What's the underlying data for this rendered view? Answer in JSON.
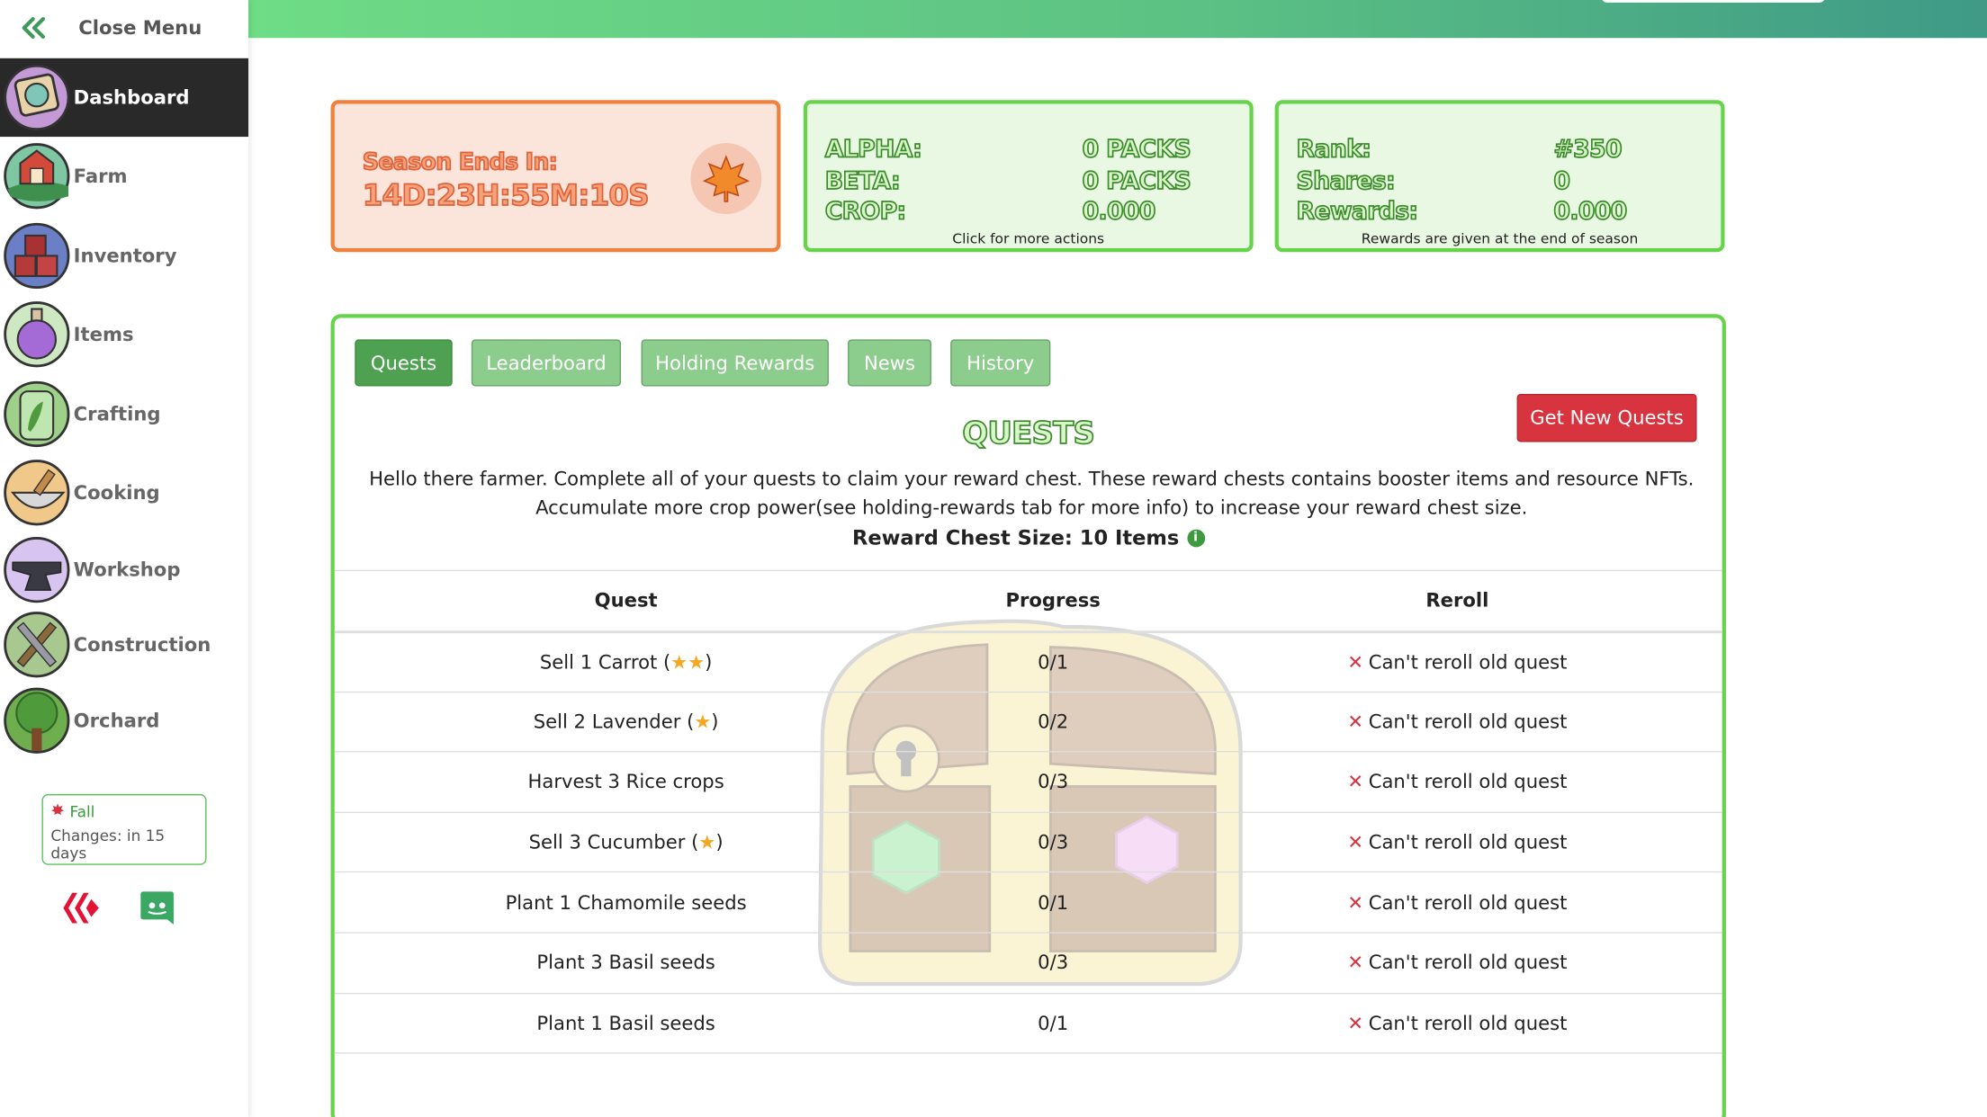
{
  "sidebar": {
    "close_menu": "Close Menu",
    "items": [
      {
        "label": "Dashboard"
      },
      {
        "label": "Farm"
      },
      {
        "label": "Inventory"
      },
      {
        "label": "Items"
      },
      {
        "label": "Crafting"
      },
      {
        "label": "Cooking"
      },
      {
        "label": "Workshop"
      },
      {
        "label": "Construction"
      },
      {
        "label": "Orchard"
      }
    ],
    "season": {
      "name": "Fall",
      "changes": "Changes: in 15 days"
    }
  },
  "cards": {
    "season": {
      "title": "Season Ends In:",
      "time": "14D:23H:55M:10S"
    },
    "packs": {
      "rows": [
        {
          "label": "ALPHA:",
          "value": "0 PACKS"
        },
        {
          "label": "BETA:",
          "value": "0 PACKS"
        },
        {
          "label": "CROP:",
          "value": "0.000"
        }
      ],
      "note": "Click for more actions"
    },
    "rank": {
      "rows": [
        {
          "label": "Rank:",
          "value": "#350"
        },
        {
          "label": "Shares:",
          "value": "0"
        },
        {
          "label": "Rewards:",
          "value": "0.000"
        }
      ],
      "note": "Rewards are given at the end of season"
    }
  },
  "tabs": [
    {
      "label": "Quests",
      "active": true
    },
    {
      "label": "Leaderboard"
    },
    {
      "label": "Holding Rewards"
    },
    {
      "label": "News"
    },
    {
      "label": "History"
    }
  ],
  "quests": {
    "new_button": "Get New Quests",
    "title": "QUESTS",
    "intro": "Hello there farmer. Complete all of your quests to claim your reward chest. These reward chests contains booster items and resource NFTs. Accumulate more crop power(see holding-rewards tab for more info) to increase your reward chest size.",
    "chest_size": "Reward Chest Size: 10 Items",
    "headers": {
      "quest": "Quest",
      "progress": "Progress",
      "reroll": "Reroll"
    },
    "rows": [
      {
        "quest": "Sell 1 Carrot",
        "stars": 2,
        "progress": "0/1",
        "reroll": "Can't reroll old quest"
      },
      {
        "quest": "Sell 2 Lavender",
        "stars": 1,
        "progress": "0/2",
        "reroll": "Can't reroll old quest"
      },
      {
        "quest": "Harvest 3 Rice crops",
        "stars": 0,
        "progress": "0/3",
        "reroll": "Can't reroll old quest"
      },
      {
        "quest": "Sell 3 Cucumber",
        "stars": 1,
        "progress": "0/3",
        "reroll": "Can't reroll old quest"
      },
      {
        "quest": "Plant 1 Chamomile seeds",
        "stars": 0,
        "progress": "0/1",
        "reroll": "Can't reroll old quest"
      },
      {
        "quest": "Plant 3 Basil seeds",
        "stars": 0,
        "progress": "0/3",
        "reroll": "Can't reroll old quest"
      },
      {
        "quest": "Plant 1 Basil seeds",
        "stars": 0,
        "progress": "0/1",
        "reroll": "Can't reroll old quest"
      }
    ]
  },
  "colors": {
    "accent_green": "#66d44a",
    "season_orange": "#f0803c",
    "danger_red": "#d8343f"
  }
}
